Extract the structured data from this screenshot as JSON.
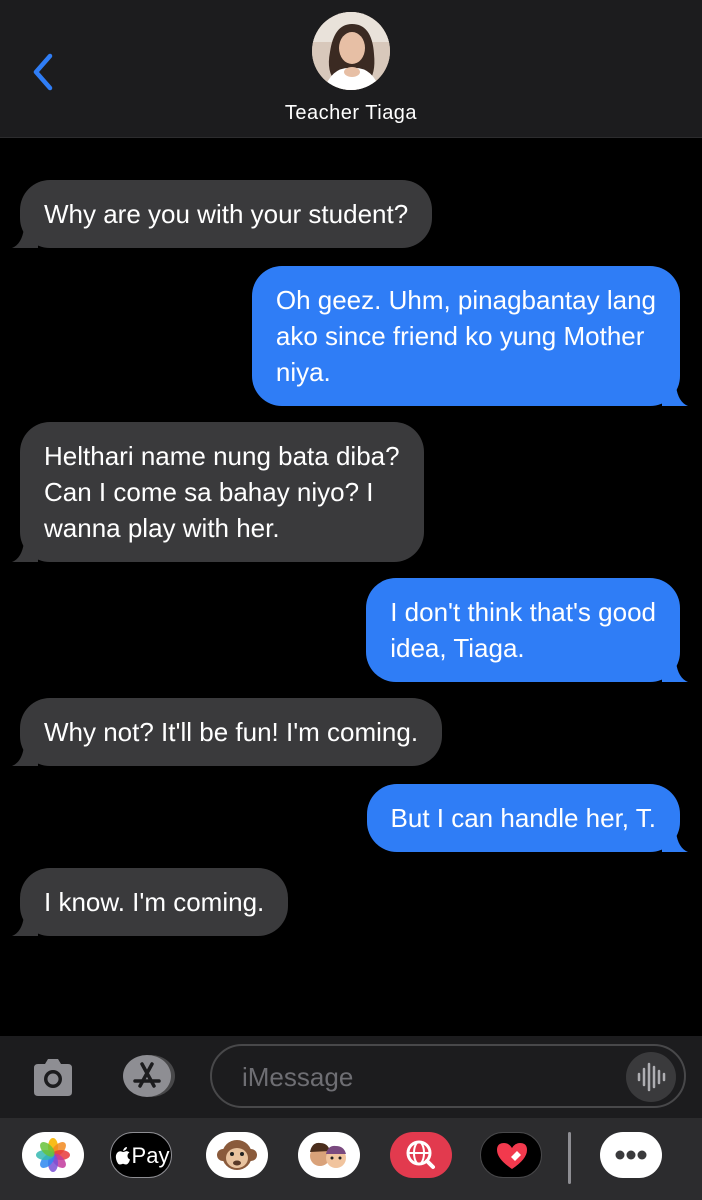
{
  "header": {
    "contact_name": "Teacher Tiaga",
    "avatar": "contact-photo"
  },
  "messages": [
    {
      "direction": "incoming",
      "text": "Why are you with your student?"
    },
    {
      "direction": "outgoing",
      "lines": [
        "Oh geez. Uhm, pinagbantay lang",
        "ako since friend ko yung Mother",
        "niya."
      ]
    },
    {
      "direction": "incoming",
      "lines": [
        "Helthari name nung bata diba?",
        "Can I come sa bahay niyo? I",
        "wanna play with her."
      ]
    },
    {
      "direction": "outgoing",
      "lines": [
        "I don't think that's good",
        "idea, Tiaga."
      ]
    },
    {
      "direction": "incoming",
      "text": "Why not? It'll be fun! I'm coming."
    },
    {
      "direction": "outgoing",
      "text": "But I can handle her, T."
    },
    {
      "direction": "incoming",
      "text": "I know. I'm coming."
    }
  ],
  "composer": {
    "placeholder": "iMessage",
    "icons": [
      "camera-icon",
      "app-store-icon",
      "audio-waveform-icon"
    ]
  },
  "app_drawer": {
    "pay_label": "Pay",
    "apps": [
      "photos-app",
      "apple-pay-app",
      "animoji-app",
      "memoji-app",
      "image-search-app",
      "digital-touch-app",
      "more-apps"
    ]
  },
  "colors": {
    "outgoing_bubble": "#2f7df6",
    "incoming_bubble": "#3a3a3c",
    "back_chevron": "#2f7df6"
  }
}
